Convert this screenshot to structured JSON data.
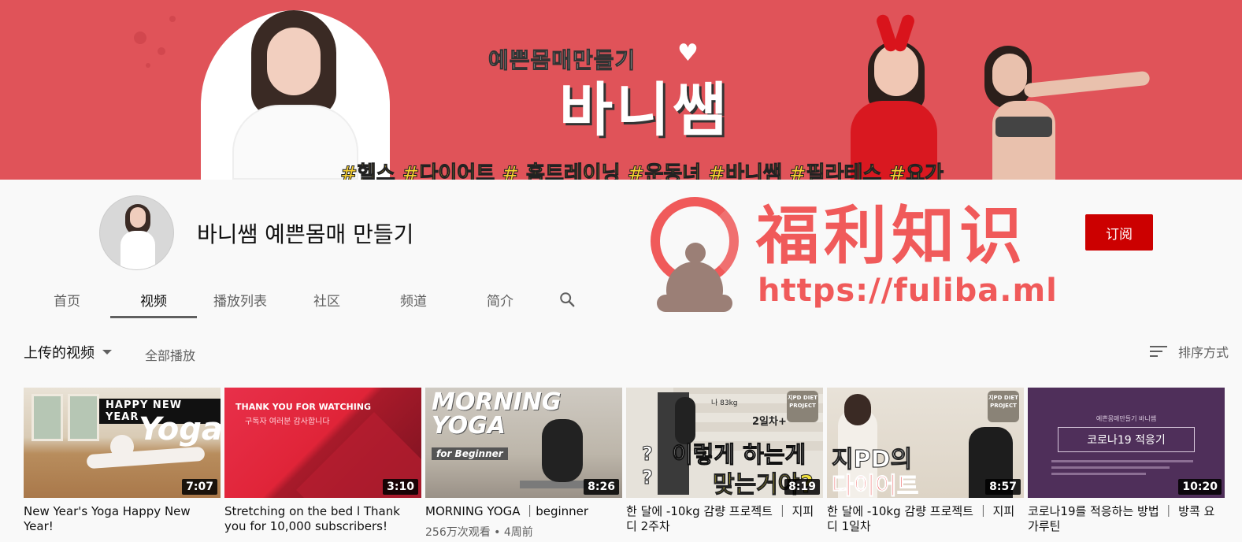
{
  "banner": {
    "subtitle": "예쁜몸매만들기",
    "heart": "♥",
    "title": "바니쌤",
    "hashtags": "#헬스 #다이어트 # 홈트레이닝 #운동녀 #바니쌤 #필라테스 #요가"
  },
  "channel": {
    "name": "바니쌤 예쁜몸매 만들기",
    "subscribe_label": "订阅"
  },
  "tabs": [
    {
      "label": "首页",
      "active": false
    },
    {
      "label": "视频",
      "active": true
    },
    {
      "label": "播放列表",
      "active": false
    },
    {
      "label": "社区",
      "active": false
    },
    {
      "label": "频道",
      "active": false
    },
    {
      "label": "简介",
      "active": false
    }
  ],
  "watermark": {
    "title": "福利知识",
    "url": "https://fuliba.ml"
  },
  "section": {
    "uploads_label": "上传的视频",
    "play_all_label": "全部播放",
    "sort_label": "排序方式"
  },
  "videos": [
    {
      "title": "New Year's Yoga Happy New Year!",
      "duration": "7:07",
      "meta": "",
      "thumb": {
        "banner": "HAPPY NEW YEAR",
        "big": "Yoga"
      }
    },
    {
      "title": "Stretching on the bed l Thank you for 10,000 subscribers!",
      "duration": "3:10",
      "meta": "",
      "thumb": {
        "line1": "THANK YOU FOR WATCHING",
        "line2": "구독자 여러분 감사합니다"
      }
    },
    {
      "title": "MORNING YOGA ｜beginner",
      "duration": "8:26",
      "meta": "256万次观看 • 4周前",
      "thumb": {
        "big": "MORNING YOGA",
        "small": "for Beginner"
      }
    },
    {
      "title": "한 달에 -10kg 감량 프로젝트 ｜ 지피디 2주차",
      "duration": "8:19",
      "meta": "",
      "thumb": {
        "line1": "이렇게 하는게",
        "line2": "맞는거야?",
        "badge": "지PD DIET PROJECT",
        "note": "나 83kg",
        "tag": "2일차+"
      }
    },
    {
      "title": "한 달에 -10kg 감량 프로젝트 ｜ 지피디 1일차",
      "duration": "8:57",
      "meta": "",
      "thumb": {
        "line1": "지PD의",
        "line2": "다이어트",
        "badge": "지PD DIET PROJECT"
      }
    },
    {
      "title": "코로나19를 적응하는 방법 ｜ 방콕 요가루틴",
      "duration": "10:20",
      "meta": "",
      "thumb": {
        "small": "예쁜몸매만들기 바니쌤",
        "box": "코로나19 적응기"
      }
    }
  ]
}
